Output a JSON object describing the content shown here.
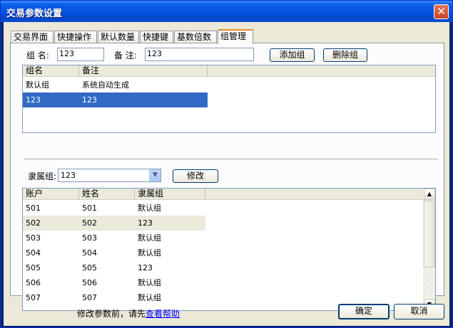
{
  "window": {
    "title": "交易参数设置",
    "close_glyph": "✕"
  },
  "tabs": [
    {
      "label": "交易界面"
    },
    {
      "label": "快捷操作"
    },
    {
      "label": "默认数量"
    },
    {
      "label": "快捷键"
    },
    {
      "label": "基数倍数"
    },
    {
      "label": "组管理"
    }
  ],
  "group_form": {
    "name_label": "组  名:",
    "name_value": "123",
    "remark_label": "备  注:",
    "remark_value": "123",
    "add_button": "添加组",
    "delete_button": "删除组"
  },
  "group_list": {
    "columns": [
      "组名",
      "备注"
    ],
    "rows": [
      {
        "name": "默认组",
        "remark": "系统自动生成"
      },
      {
        "name": "123",
        "remark": "123"
      }
    ]
  },
  "belong_form": {
    "label": "隶属组:",
    "selected": "123",
    "modify_button": "修改"
  },
  "account_list": {
    "columns": [
      "账户",
      "姓名",
      "隶属组"
    ],
    "rows": [
      {
        "account": "501",
        "name": "501",
        "group": "默认组"
      },
      {
        "account": "502",
        "name": "502",
        "group": "123"
      },
      {
        "account": "503",
        "name": "503",
        "group": "默认组"
      },
      {
        "account": "504",
        "name": "504",
        "group": "默认组"
      },
      {
        "account": "505",
        "name": "505",
        "group": "123"
      },
      {
        "account": "506",
        "name": "506",
        "group": "默认组"
      },
      {
        "account": "507",
        "name": "507",
        "group": "默认组"
      }
    ]
  },
  "footer": {
    "hint_prefix": "修改参数前，请先",
    "help_link": "查看帮助",
    "ok_button": "确定",
    "cancel_button": "取消"
  },
  "icons": {
    "dropdown": "chevron-down-icon",
    "scroll_up": "arrow-up-icon",
    "scroll_down": "arrow-down-icon"
  },
  "colors": {
    "titlebar": "#0553e0",
    "selection": "#316ac5",
    "active_tab_accent": "#e68b2c",
    "link": "#0000ff"
  }
}
